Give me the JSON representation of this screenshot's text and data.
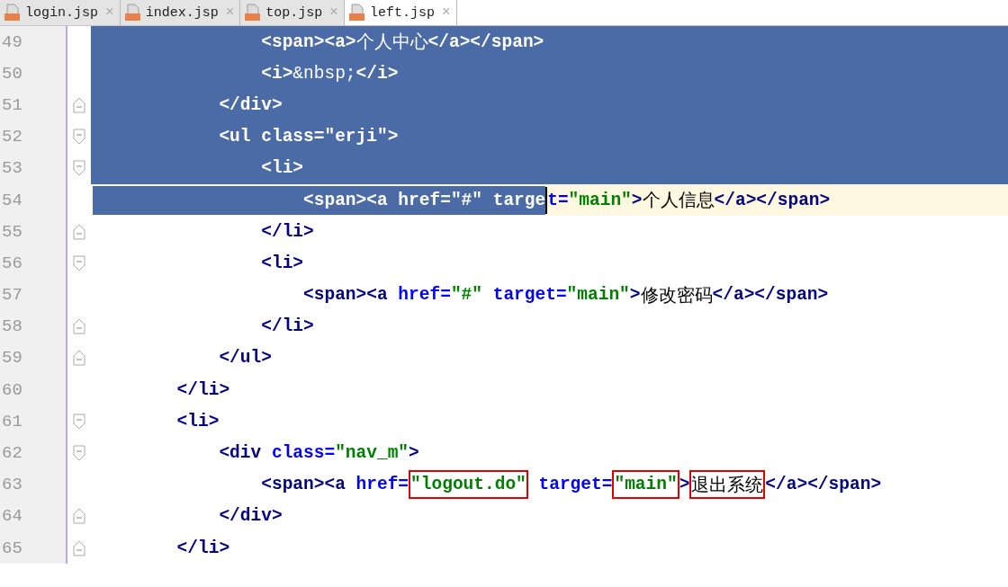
{
  "tabs": [
    {
      "label": "login.jsp",
      "close": "×",
      "selected": false
    },
    {
      "label": "index.jsp",
      "close": "×",
      "selected": false
    },
    {
      "label": "top.jsp",
      "close": "×",
      "selected": false
    },
    {
      "label": "left.jsp",
      "close": "×",
      "selected": true
    }
  ],
  "editor": {
    "lines": [
      {
        "number": "49",
        "kind": "plain",
        "selected": true,
        "current": false,
        "tokens": [
          {
            "kind": "tag",
            "text": "                <span><a>"
          },
          {
            "kind": "text",
            "text": "个人中心"
          },
          {
            "kind": "tag",
            "text": "</a></span>"
          }
        ]
      },
      {
        "number": "50",
        "kind": "plain",
        "selected": true,
        "current": false,
        "tokens": [
          {
            "kind": "tag",
            "text": "                <i>"
          },
          {
            "kind": "text",
            "text": "&nbsp;"
          },
          {
            "kind": "tag",
            "text": "</i>"
          }
        ]
      },
      {
        "number": "51",
        "kind": "fold-end",
        "selected": true,
        "current": false,
        "tokens": [
          {
            "kind": "tag",
            "text": "            </div>"
          }
        ]
      },
      {
        "number": "52",
        "kind": "fold-start",
        "selected": true,
        "current": false,
        "tokens": [
          {
            "kind": "tag",
            "text": "            <ul"
          },
          {
            "kind": "attr",
            "text": " class="
          },
          {
            "kind": "string",
            "text": "\"erji\""
          },
          {
            "kind": "tag",
            "text": ">"
          }
        ]
      },
      {
        "number": "53",
        "kind": "fold-start",
        "selected": true,
        "current": false,
        "tokens": [
          {
            "kind": "tag",
            "text": "                <li>"
          }
        ]
      },
      {
        "number": "54",
        "kind": "plain",
        "selected": true,
        "current": true,
        "tokens": [
          {
            "kind": "tag",
            "text": "                    <span><a"
          },
          {
            "kind": "attr",
            "text": " href="
          },
          {
            "kind": "string",
            "text": "\"#\""
          },
          {
            "kind": "attr",
            "text": " targe"
          },
          {
            "kind": "caret"
          },
          {
            "kind": "attr",
            "text": "t="
          },
          {
            "kind": "string",
            "text": "\"main\""
          },
          {
            "kind": "tag",
            "text": ">"
          },
          {
            "kind": "text",
            "text": "个人信息"
          },
          {
            "kind": "tag",
            "text": "</a></span>"
          }
        ]
      },
      {
        "number": "55",
        "kind": "fold-end",
        "selected": false,
        "current": false,
        "tokens": [
          {
            "kind": "tag",
            "text": "                </li>"
          }
        ]
      },
      {
        "number": "56",
        "kind": "fold-start",
        "selected": false,
        "current": false,
        "tokens": [
          {
            "kind": "tag",
            "text": "                <li>"
          }
        ]
      },
      {
        "number": "57",
        "kind": "plain",
        "selected": false,
        "current": false,
        "tokens": [
          {
            "kind": "tag",
            "text": "                    <span><a"
          },
          {
            "kind": "attr",
            "text": " href="
          },
          {
            "kind": "string",
            "text": "\"#\""
          },
          {
            "kind": "attr",
            "text": " target="
          },
          {
            "kind": "string",
            "text": "\"main\""
          },
          {
            "kind": "tag",
            "text": ">"
          },
          {
            "kind": "text",
            "text": "修改密码"
          },
          {
            "kind": "tag",
            "text": "</a></span>"
          }
        ]
      },
      {
        "number": "58",
        "kind": "fold-end",
        "selected": false,
        "current": false,
        "tokens": [
          {
            "kind": "tag",
            "text": "                </li>"
          }
        ]
      },
      {
        "number": "59",
        "kind": "fold-end",
        "selected": false,
        "current": false,
        "tokens": [
          {
            "kind": "tag",
            "text": "            </ul>"
          }
        ]
      },
      {
        "number": "60",
        "kind": "plain",
        "selected": false,
        "current": false,
        "tokens": [
          {
            "kind": "tag",
            "text": "        </li>"
          }
        ]
      },
      {
        "number": "61",
        "kind": "fold-start",
        "selected": false,
        "current": false,
        "tokens": [
          {
            "kind": "tag",
            "text": "        <li>"
          }
        ]
      },
      {
        "number": "62",
        "kind": "fold-start",
        "selected": false,
        "current": false,
        "tokens": [
          {
            "kind": "tag",
            "text": "            <div"
          },
          {
            "kind": "attr",
            "text": " class="
          },
          {
            "kind": "string",
            "text": "\"nav_m\""
          },
          {
            "kind": "tag",
            "text": ">"
          }
        ]
      },
      {
        "number": "63",
        "kind": "plain",
        "selected": false,
        "current": false,
        "tokens": [
          {
            "kind": "tag",
            "text": "                <span><a"
          },
          {
            "kind": "attr",
            "text": " href="
          },
          {
            "kind": "boxed-string",
            "text": "\"logout.do\""
          },
          {
            "kind": "attr",
            "text": " target="
          },
          {
            "kind": "boxed-string",
            "text": "\"main\""
          },
          {
            "kind": "tag",
            "text": ">"
          },
          {
            "kind": "boxed-text",
            "text": "退出系统"
          },
          {
            "kind": "tag",
            "text": "</a></span>"
          }
        ]
      },
      {
        "number": "64",
        "kind": "fold-end",
        "selected": false,
        "current": false,
        "tokens": [
          {
            "kind": "tag",
            "text": "            </div>"
          }
        ]
      },
      {
        "number": "65",
        "kind": "fold-end",
        "selected": false,
        "current": false,
        "tokens": [
          {
            "kind": "tag",
            "text": "        </li>"
          }
        ]
      }
    ]
  }
}
